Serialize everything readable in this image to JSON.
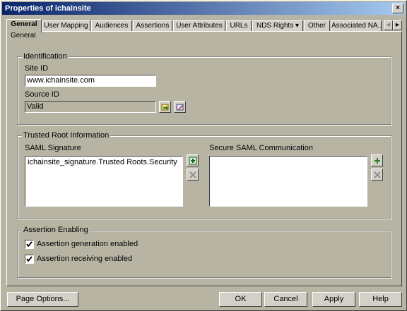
{
  "window": {
    "title": "Properties of ichainsite",
    "close_glyph": "×"
  },
  "tabs": [
    {
      "label": "General",
      "active": true
    },
    {
      "label": "User Mapping"
    },
    {
      "label": "Audiences"
    },
    {
      "label": "Assertions"
    },
    {
      "label": "User Attributes"
    },
    {
      "label": "URLs"
    },
    {
      "label": "NDS Rights ▾"
    },
    {
      "label": "Other"
    },
    {
      "label": "Associated NA..."
    }
  ],
  "subtab": {
    "label": "General"
  },
  "identification": {
    "legend": "Identification",
    "site_id_label": "Site ID",
    "site_id_value": "www.ichainsite.com",
    "source_id_label": "Source ID",
    "source_id_value": "Valid"
  },
  "trusted_root": {
    "legend": "Trusted Root Information",
    "saml_signature_label": "SAML Signature",
    "saml_signature_items": [
      "ichainsite_signature.Trusted Roots.Security"
    ],
    "secure_saml_label": "Secure SAML Communication",
    "secure_saml_items": []
  },
  "assertion": {
    "legend": "Assertion Enabling",
    "generation_label": "Assertion generation enabled",
    "generation_checked": true,
    "receiving_label": "Assertion receiving enabled",
    "receiving_checked": true
  },
  "buttons": {
    "page_options": "Page Options...",
    "ok": "OK",
    "cancel": "Cancel",
    "apply": "Apply",
    "help": "Help"
  }
}
